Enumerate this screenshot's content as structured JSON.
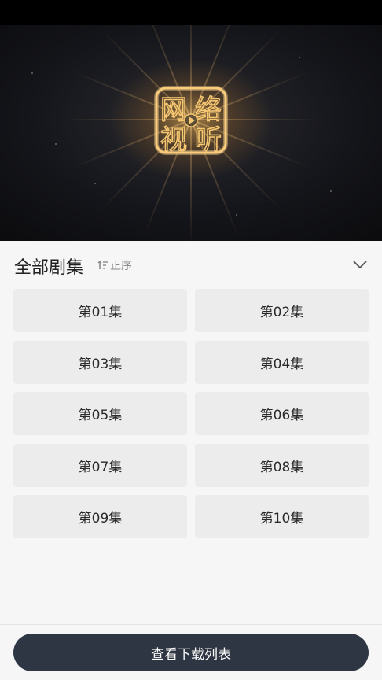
{
  "player": {
    "logo_text": "网络视听"
  },
  "episodes_header": {
    "title": "全部剧集",
    "sort_label": "正序"
  },
  "episodes": [
    {
      "label": "第01集"
    },
    {
      "label": "第02集"
    },
    {
      "label": "第03集"
    },
    {
      "label": "第04集"
    },
    {
      "label": "第05集"
    },
    {
      "label": "第06集"
    },
    {
      "label": "第07集"
    },
    {
      "label": "第08集"
    },
    {
      "label": "第09集"
    },
    {
      "label": "第10集"
    }
  ],
  "footer": {
    "download_label": "查看下载列表"
  },
  "colors": {
    "button_bg": "#2f3643",
    "tile_bg": "#ececec",
    "page_bg": "#f6f6f6",
    "logo_gold": "#f0b24a"
  },
  "icons": [
    "sort-ascending-icon",
    "chevron-down-icon",
    "play-icon"
  ]
}
